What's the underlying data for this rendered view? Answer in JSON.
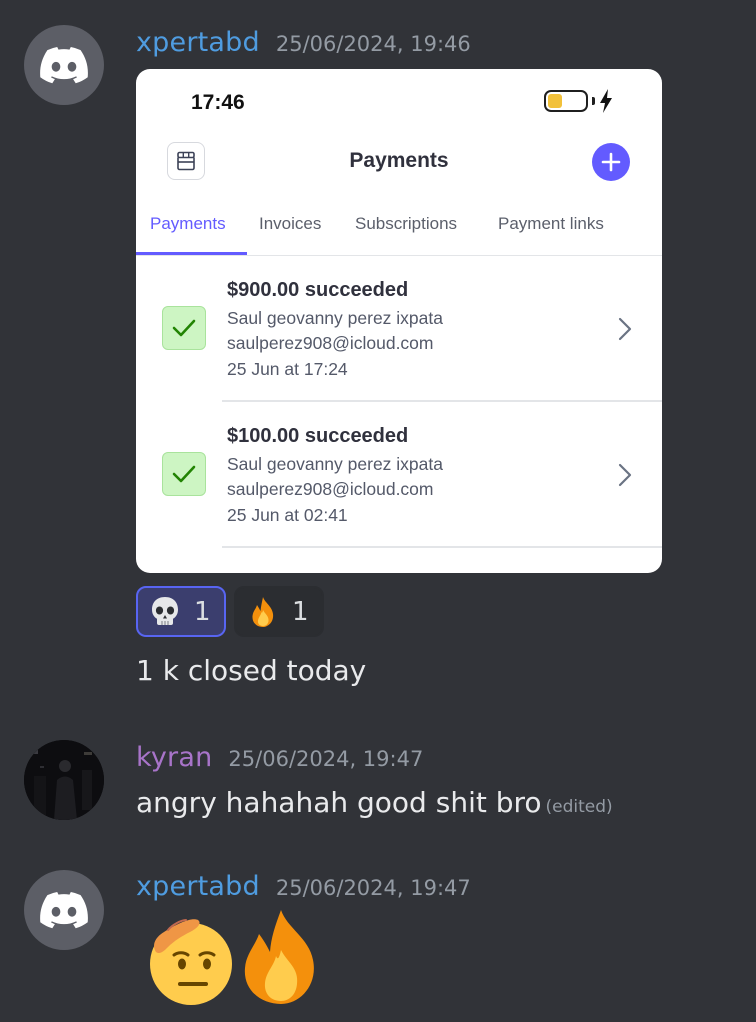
{
  "messages": [
    {
      "username": "xpertabd",
      "timestamp": "25/06/2024, 19:46",
      "attachment": {
        "status_time": "17:46",
        "nav_title": "Payments",
        "tabs": [
          "Payments",
          "Invoices",
          "Subscriptions",
          "Payment links"
        ],
        "active_tab": "Payments",
        "payments": [
          {
            "amount": "$900.00 succeeded",
            "name": "Saul geovanny perez ixpata",
            "email": "saulperez908@icloud.com",
            "date": "25 Jun at 17:24"
          },
          {
            "amount": "$100.00 succeeded",
            "name": "Saul geovanny perez ixpata",
            "email": "saulperez908@icloud.com",
            "date": "25 Jun at 02:41"
          }
        ],
        "battery_level": 0.4
      },
      "reactions": [
        {
          "emoji": "skull",
          "count": "1",
          "reacted_by_me": true
        },
        {
          "emoji": "fire",
          "count": "1",
          "reacted_by_me": false
        }
      ],
      "text": "1 k closed today"
    },
    {
      "username": "kyran",
      "timestamp": "25/06/2024, 19:47",
      "text": "angry hahahah good shit bro",
      "edited_label": "(edited)"
    },
    {
      "username": "xpertabd",
      "timestamp": "25/06/2024, 19:47",
      "emojis": [
        "saluting-face",
        "fire"
      ]
    }
  ],
  "colors": {
    "background": "#313338",
    "username_blue": "#4f9ce0",
    "username_purple": "#a874c9",
    "accent": "#635bff",
    "reaction_active_border": "#5865f2"
  }
}
